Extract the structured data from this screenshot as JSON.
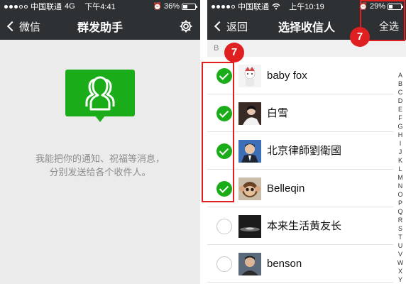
{
  "left": {
    "status": {
      "carrier": "中国联通",
      "network": "4G",
      "time": "下午4:41",
      "battery": "36%",
      "battery_level": 0.36
    },
    "nav": {
      "back_label": "微信",
      "title": "群发助手"
    },
    "description_line1": "我能把你的通知、祝福等消息，",
    "description_line2": "分别发送给各个收件人。"
  },
  "right": {
    "status": {
      "carrier": "中国联通",
      "time": "上午10:19",
      "battery": "29%",
      "battery_level": 0.29
    },
    "nav": {
      "back_label": "返回",
      "title": "选择收信人",
      "select_all_label": "全选"
    },
    "section_letter": "B",
    "contacts": [
      {
        "name": "baby fox",
        "checked": true
      },
      {
        "name": "白雪",
        "checked": true
      },
      {
        "name": "北京律師劉衛國",
        "checked": true
      },
      {
        "name": "Belleqin",
        "checked": true
      },
      {
        "name": "本来生活黄友长",
        "checked": false
      },
      {
        "name": "benson",
        "checked": false
      }
    ],
    "index_letters": [
      "A",
      "B",
      "C",
      "D",
      "E",
      "F",
      "G",
      "H",
      "I",
      "J",
      "K",
      "L",
      "M",
      "N",
      "O",
      "P",
      "Q",
      "R",
      "S",
      "T",
      "U",
      "V",
      "W",
      "X",
      "Y",
      "Z"
    ]
  },
  "annotations": {
    "step_number_left": "7",
    "step_number_right": "7"
  },
  "colors": {
    "wechat_green": "#1aad19",
    "navbar": "#2e3134",
    "annotation_red": "#e02020"
  }
}
